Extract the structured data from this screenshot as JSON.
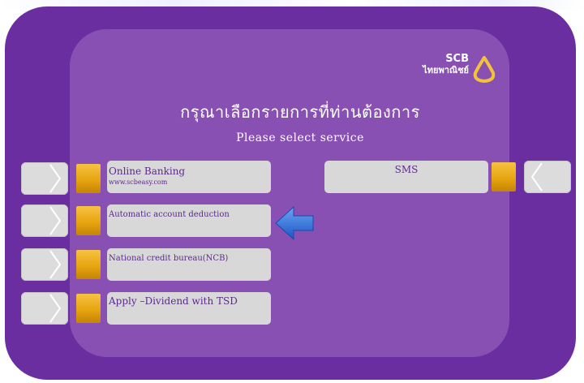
{
  "brand": {
    "line1": "SCB",
    "line2": "ไทยพาณิชย์",
    "color": "#4fd0f0"
  },
  "title_thai": "กรุณาเลือกรายการที่ท่านต้องการ",
  "title_en": "Please select  service",
  "colors": {
    "frame": "#6a2ea0",
    "screen": "#8950b4",
    "button": "#d8d8d8",
    "select_key": "#f0b429",
    "text": "#5a2a8a",
    "pointer": "#2a6cd8"
  },
  "left_options": [
    {
      "label": "Online Banking",
      "sub": "www.scbeasy.com"
    },
    {
      "label": "Automatic account deduction"
    },
    {
      "label": "National credit bureau(NCB)"
    },
    {
      "label": "Apply –Dividend with TSD"
    }
  ],
  "right_options": [
    {
      "label": "SMS"
    }
  ],
  "pointer_icon": "left-arrow-icon"
}
